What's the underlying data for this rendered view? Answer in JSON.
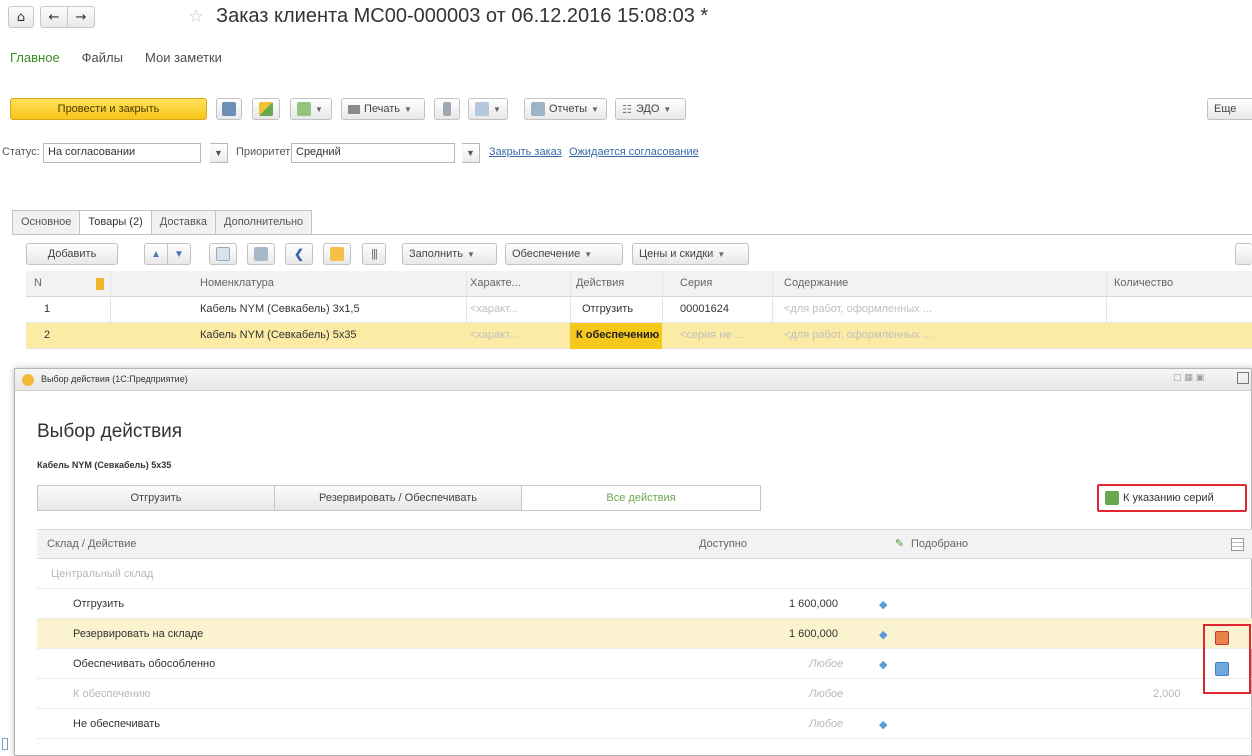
{
  "window": {
    "title": "Заказ клиента МС00-000003 от 06.12.2016 15:08:03 *",
    "home_icon": "home-icon",
    "back_icon": "arrow-left-icon",
    "forward_icon": "arrow-right-icon",
    "favorite_icon": "star-icon"
  },
  "sections": [
    {
      "label": "Главное",
      "active": true
    },
    {
      "label": "Файлы",
      "active": false
    },
    {
      "label": "Мои заметки",
      "active": false
    }
  ],
  "toolbar": {
    "post_close": "Провести и закрыть",
    "print": "Печать",
    "reports": "Отчеты",
    "edo": "ЭДО",
    "more": "Еще"
  },
  "status_bar": {
    "status_label": "Статус:",
    "status_value": "На согласовании",
    "priority_label": "Приоритет:",
    "priority_value": "Средний",
    "close_order_link": "Закрыть заказ",
    "pending_link": "Ожидается согласование"
  },
  "tabs": [
    {
      "label": "Основное",
      "active": false
    },
    {
      "label": "Товары (2)",
      "active": true
    },
    {
      "label": "Доставка",
      "active": false
    },
    {
      "label": "Дополнительно",
      "active": false
    }
  ],
  "grid_toolbar": {
    "add": "Добавить",
    "fill": "Заполнить",
    "provision": "Обеспечение",
    "prices": "Цены и скидки"
  },
  "grid": {
    "columns": [
      "N",
      "Номенклатура",
      "Характе...",
      "Действия",
      "Серия",
      "Содержание",
      "Количество"
    ],
    "rows": [
      {
        "n": "1",
        "item": "Кабель NYM (Севкабель) 3х1,5",
        "char": "<характ...",
        "action": "Отгрузить",
        "series": "00001624",
        "content": "<для работ, оформленных ...",
        "qty": ""
      },
      {
        "n": "2",
        "item": "Кабель NYM (Севкабель) 5х35",
        "char": "<характ...",
        "action": "К обеспечению",
        "series": "<серия не ...",
        "content": "<для работ, оформленных ...",
        "qty": ""
      }
    ]
  },
  "dialog": {
    "window_title": "Выбор действия (1С:Предприятие)",
    "heading": "Выбор действия",
    "item_name": "Кабель NYM (Севкабель) 5х35",
    "segments": [
      "Отгрузить",
      "Резервировать / Обеспечивать",
      "Все действия"
    ],
    "serial_button": "К указанию серий",
    "columns": {
      "warehouse_action": "Склад / Действие",
      "available": "Доступно",
      "picked": "Подобрано"
    },
    "rows": [
      {
        "label": "Центральный склад",
        "available": "",
        "picked": "",
        "group": true
      },
      {
        "label": "Отгрузить",
        "available": "1 600,000",
        "picked": "",
        "group": false
      },
      {
        "label": "Резервировать на складе",
        "available": "1 600,000",
        "picked": "",
        "group": false
      },
      {
        "label": "Обеспечивать обособленно",
        "available": "Любое",
        "picked": "",
        "group": false
      },
      {
        "label": "К обеспечению",
        "available": "Любое",
        "picked": "2,000",
        "group": false
      },
      {
        "label": "Не обеспечивать",
        "available": "Любое",
        "picked": "",
        "group": false
      }
    ]
  },
  "colors": {
    "primary_button": "#f7c51b",
    "selected_row": "#fbeba5",
    "action_cell": "#f6c81c",
    "highlight_box": "#e2262f",
    "active_section": "#3b8a24",
    "link": "#3a6aa8"
  }
}
